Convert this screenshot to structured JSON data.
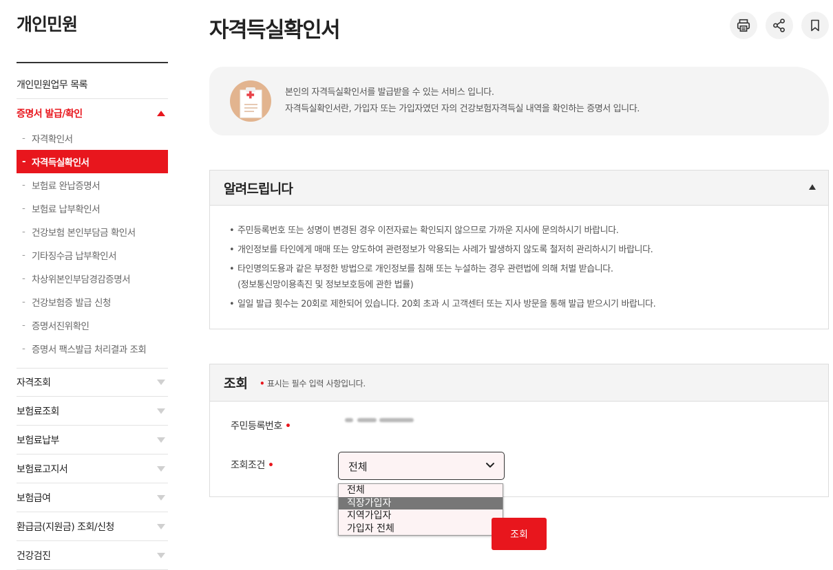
{
  "sidebar": {
    "title": "개인민원",
    "list_link": "개인민원업무 목록",
    "open_section": "증명서 발급/확인",
    "sub_items": [
      "자격확인서",
      "자격득실확인서",
      "보험료 완납증명서",
      "보험료 납부확인서",
      "건강보험 본인부담금 확인서",
      "기타징수금 납부확인서",
      "차상위본인부담경감증명서",
      "건강보험증 발급 신청",
      "증명서진위확인",
      "증명서 팩스발급 처리결과 조회"
    ],
    "active_sub_index": 1,
    "sections": [
      "자격조회",
      "보험료조회",
      "보험료납부",
      "보험료고지서",
      "보험급여",
      "환급금(지원금) 조회/신청",
      "건강검진"
    ]
  },
  "header": {
    "title": "자격득실확인서",
    "tools": [
      "print-icon",
      "share-icon",
      "bookmark-icon"
    ]
  },
  "info": {
    "icon": "document-certificate-icon",
    "line1": "본인의 자격득실확인서를 발급받을 수 있는 서비스 입니다.",
    "line2": "자격득실확인서란, 가입자 또는 가입자였던 자의 건강보험자격득실 내역을 확인하는 증명서 입니다."
  },
  "notice": {
    "title": "알려드립니다",
    "items": [
      {
        "text": "주민등록번호 또는 성명이 변경된 경우 이전자료는 확인되지 않으므로 가까운 지사에 문의하시기 바랍니다.",
        "sub": ""
      },
      {
        "text": "개인정보를 타인에게 매매 또는 양도하여 관련정보가 악용되는 사례가 발생하지 않도록 철저히 관리하시기 바랍니다.",
        "sub": ""
      },
      {
        "text": "타인명의도용과 같은 부정한 방법으로 개인정보를 침해 또는 누설하는 경우 관련법에 의해 처벌 받습니다.",
        "sub": "(정보통신망이용촉진 및 정보보호등에 관한 법률)"
      },
      {
        "text": "일일 발급 횟수는 20회로 제한되어 있습니다. 20회 초과 시 고객센터 또는 지사 방문을 통해 발급 받으시기 바랍니다.",
        "sub": ""
      }
    ]
  },
  "query": {
    "title": "조회",
    "required_note": "표시는 필수 입력 사항입니다.",
    "rrn_label": "주민등록번호",
    "condition_label": "조회조건",
    "selected": "전체",
    "options": [
      "전체",
      "직장가입자",
      "지역가입자",
      "가입자 전체"
    ],
    "highlighted_option_index": 1,
    "submit_label": "조회"
  },
  "colors": {
    "accent": "#e8161d",
    "panel_bg": "#f4f4f4",
    "select_bg": "#fdf3f4"
  }
}
